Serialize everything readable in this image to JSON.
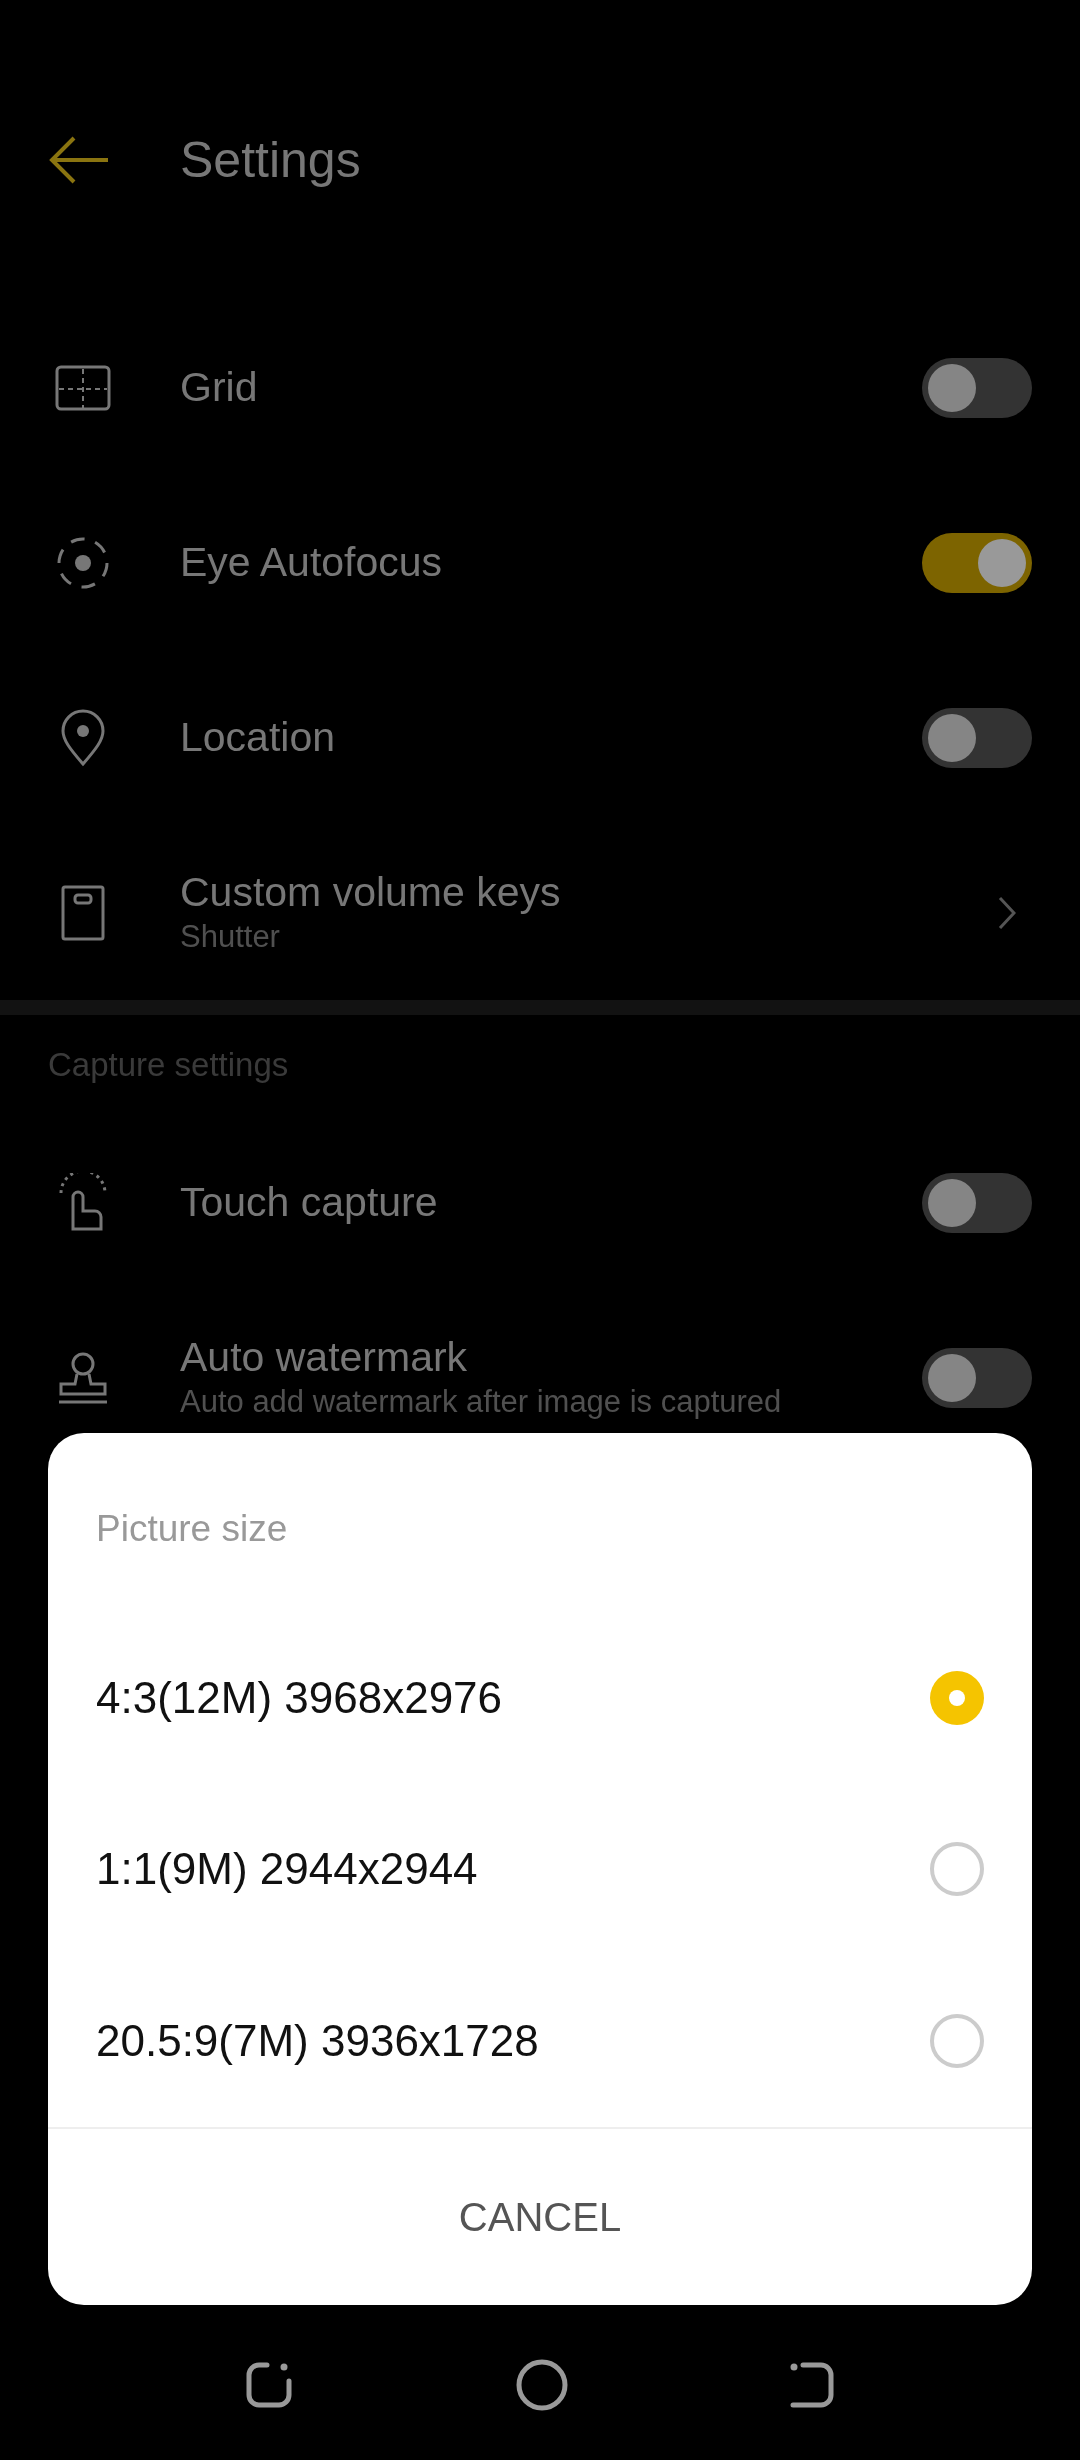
{
  "header": {
    "title": "Settings"
  },
  "general_items": [
    {
      "kind": "toggle",
      "label": "Grid",
      "on": false
    },
    {
      "kind": "toggle",
      "label": "Eye Autofocus",
      "on": true
    },
    {
      "kind": "toggle",
      "label": "Location",
      "on": false
    },
    {
      "kind": "link",
      "label": "Custom volume keys",
      "subtitle": "Shutter"
    }
  ],
  "capture_section": {
    "title": "Capture settings",
    "items": [
      {
        "kind": "toggle",
        "label": "Touch capture",
        "on": false
      },
      {
        "kind": "toggle",
        "label": "Auto watermark",
        "subtitle": "Auto add watermark after image is captured",
        "on": false
      }
    ]
  },
  "dialog": {
    "title": "Picture size",
    "options": [
      {
        "label": "4:3(12M) 3968x2976",
        "selected": true
      },
      {
        "label": "1:1(9M) 2944x2944",
        "selected": false
      },
      {
        "label": "20.5:9(7M) 3936x1728",
        "selected": false
      }
    ],
    "cancel": "CANCEL"
  }
}
